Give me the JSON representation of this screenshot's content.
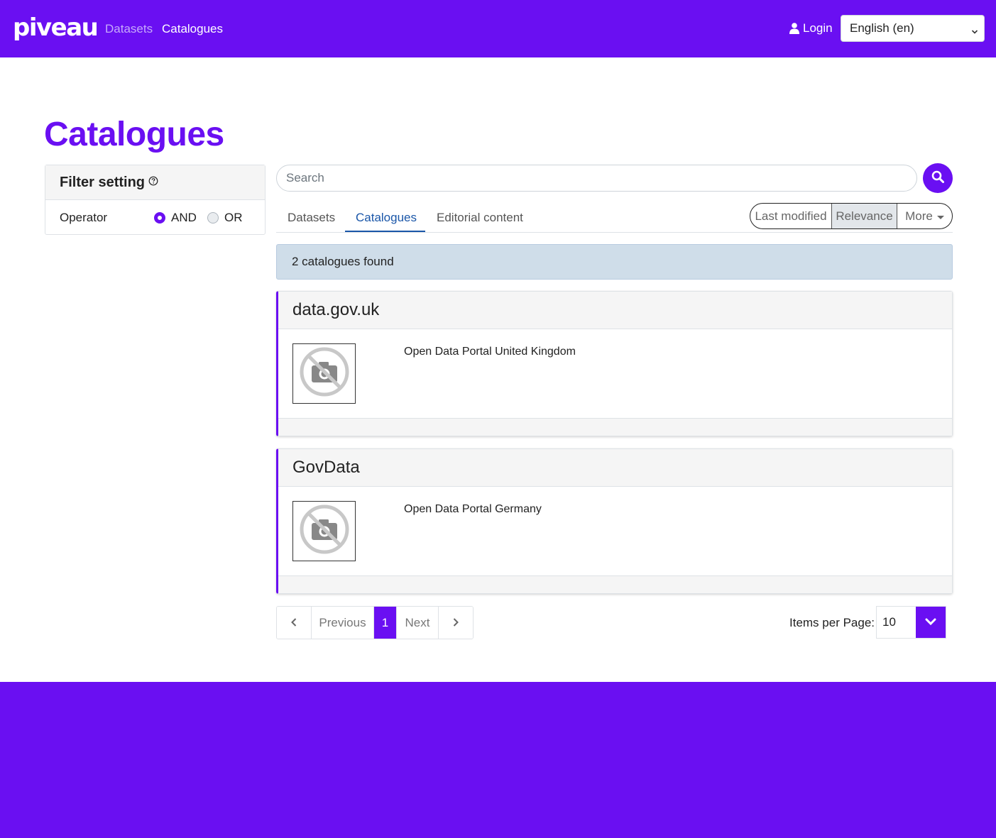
{
  "header": {
    "logo": "piveau",
    "nav": [
      {
        "label": "Datasets"
      },
      {
        "label": "Catalogues"
      }
    ],
    "login_label": "Login",
    "language_selected": "English (en)",
    "brand_color": "#6a0ff2"
  },
  "page": {
    "title": "Catalogues"
  },
  "filter": {
    "title": "Filter setting",
    "operator_label": "Operator",
    "options": [
      {
        "label": "AND",
        "selected": true
      },
      {
        "label": "OR",
        "selected": false
      }
    ]
  },
  "search": {
    "placeholder": "Search"
  },
  "tabs": [
    {
      "label": "Datasets",
      "active": false
    },
    {
      "label": "Catalogues",
      "active": true
    },
    {
      "label": "Editorial content",
      "active": false
    }
  ],
  "sort": {
    "options": [
      {
        "label": "Last modified",
        "active": false
      },
      {
        "label": "Relevance",
        "active": true
      },
      {
        "label": "More",
        "active": false
      }
    ]
  },
  "results": {
    "count_text": "2 catalogues found",
    "items": [
      {
        "title": "data.gov.uk",
        "description": "Open Data Portal United Kingdom",
        "image": "no-image-icon"
      },
      {
        "title": "GovData",
        "description": "Open Data Portal Germany",
        "image": "no-image-icon"
      }
    ]
  },
  "pagination": {
    "previous_label": "Previous",
    "current_page": "1",
    "next_label": "Next",
    "items_per_page_label": "Items per Page:",
    "items_per_page_value": "10"
  }
}
